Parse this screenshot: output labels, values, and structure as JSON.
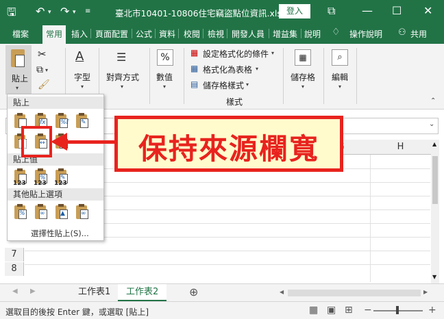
{
  "titlebar": {
    "filename": "臺北市10401-10806住宅竊盜點位資訊.xlsx...",
    "login_label": "登入"
  },
  "tabs": [
    "檔案",
    "常用",
    "插入",
    "頁面配置",
    "公式",
    "資料",
    "校閱",
    "檢視",
    "開發人員",
    "增益集",
    "說明",
    "操作說明",
    "共用"
  ],
  "ribbon": {
    "paste": "貼上",
    "font": "字型",
    "align": "對齊方式",
    "number": "數值",
    "cond_format": "設定格式化的條件",
    "format_table": "格式化為表格",
    "cell_styles": "儲存格樣式",
    "styles_group": "樣式",
    "cells": "儲存格",
    "edit": "編輯"
  },
  "grid": {
    "columns": [
      "G",
      "H"
    ],
    "rows": [
      "7",
      "8"
    ]
  },
  "dropdown": {
    "paste_header": "貼上",
    "values_header": "貼上值",
    "other_header": "其他貼上選項",
    "paste_special": "選擇性貼上(S)..."
  },
  "callout": "保持來源欄寬",
  "sheets": [
    "工作表1",
    "工作表2"
  ],
  "status": "選取目的後按 Enter 鍵，或選取 [貼上]"
}
